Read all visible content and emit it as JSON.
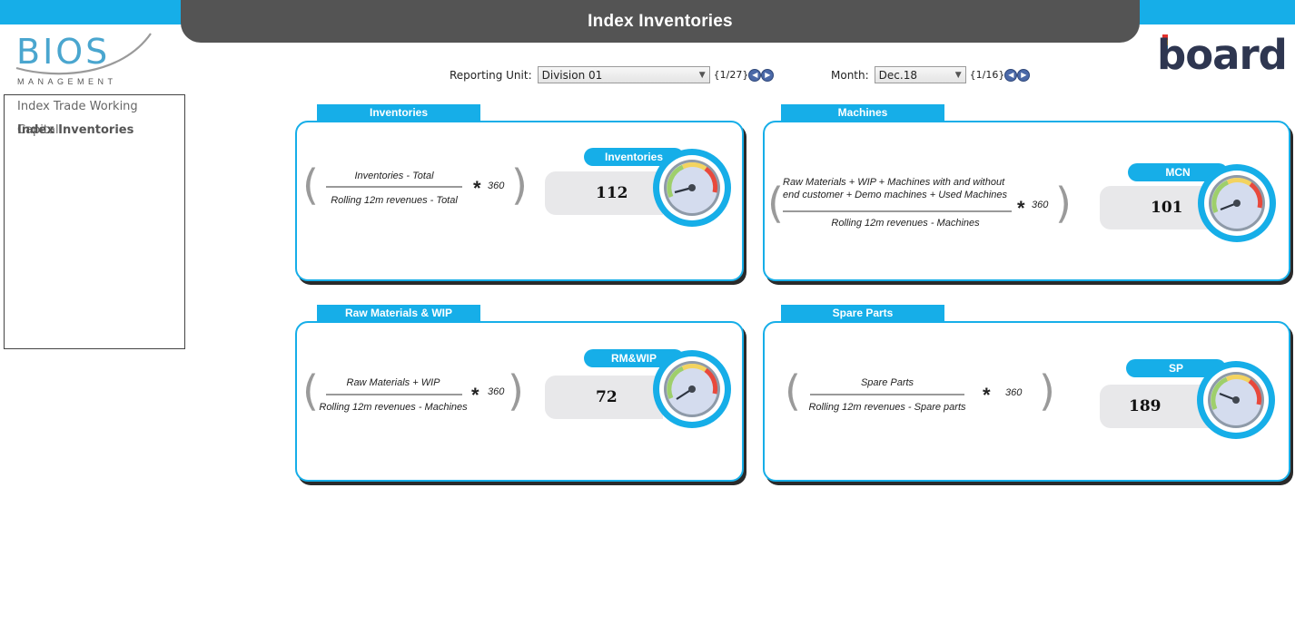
{
  "header": {
    "title": "Index Inventories"
  },
  "logos": {
    "bios": {
      "word": "BIOS",
      "sub": "MANAGEMENT"
    },
    "board": {
      "word": "board",
      "bar_colors": [
        "#e4302b",
        "#f6b500",
        "#1ba0e0"
      ]
    }
  },
  "nav": {
    "items": [
      {
        "label": "Index Trade Working Capital",
        "active": false
      },
      {
        "label": "Index Inventories",
        "active": true
      }
    ]
  },
  "selectors": {
    "reporting_unit": {
      "label": "Reporting Unit:",
      "value": "Division 01",
      "count": "{1/27}"
    },
    "month": {
      "label": "Month:",
      "value": "Dec.18",
      "count": "{1/16}"
    }
  },
  "cards": [
    {
      "tab": "Inventories",
      "numerator": "Inventories - Total",
      "denominator": "Rolling 12m revenues - Total",
      "multiplier": "360",
      "pill": "Inventories",
      "value": "112"
    },
    {
      "tab": "Machines",
      "numerator_line1": "Raw Materials + WIP + Machines with and without",
      "numerator_line2": "end customer + Demo machines + Used Machines",
      "denominator": "Rolling 12m revenues - Machines",
      "multiplier": "360",
      "pill": "MCN",
      "value": "101"
    },
    {
      "tab": "Raw Materials & WIP",
      "numerator": "Raw Materials + WIP",
      "denominator": "Rolling 12m revenues - Machines",
      "multiplier": "360",
      "pill": "RM&WIP",
      "value": "72"
    },
    {
      "tab": "Spare Parts",
      "numerator": "Spare Parts",
      "denominator": "Rolling 12m revenues - Spare parts",
      "multiplier": "360",
      "pill": "SP",
      "value": "189"
    }
  ],
  "colors": {
    "accent": "#16aee8",
    "title_bar": "#545454",
    "value_bg": "#e8e8ea"
  }
}
